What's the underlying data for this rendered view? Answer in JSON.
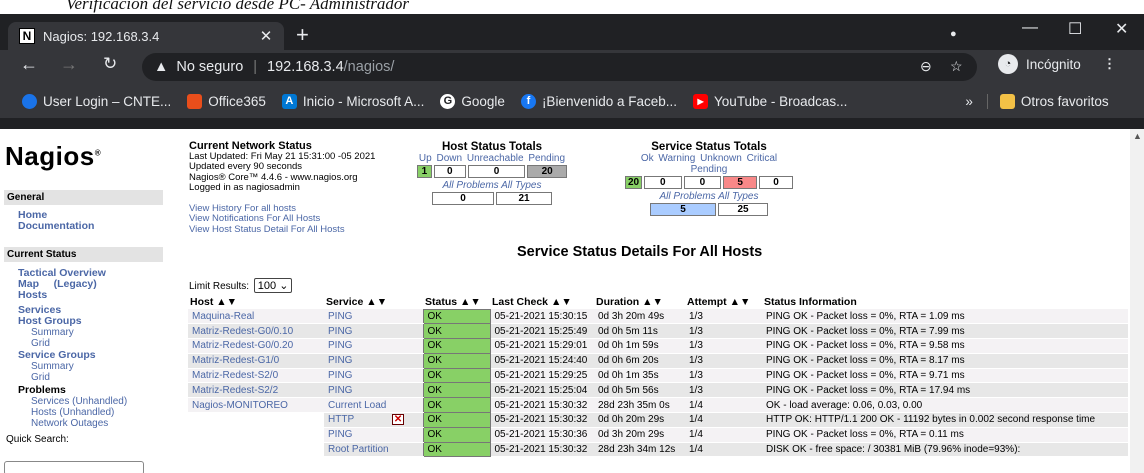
{
  "doc_caption": "Verificación del servicio desde PC- Administrador",
  "browser": {
    "tab_title": "Nagios: 192.168.3.4",
    "tab_favicon": "N",
    "security_label": "No seguro",
    "url_host": "192.168.3.4",
    "url_path": "/nagios/",
    "incognito_label": "Incógnito",
    "bookmarks": [
      {
        "label": "User Login – CNTE...",
        "icon": "blue-dot-icon",
        "color": "#1a73e8"
      },
      {
        "label": "Office365",
        "icon": "office-icon",
        "color": "#e94e1b"
      },
      {
        "label": "Inicio - Microsoft A...",
        "icon": "azure-icon",
        "color": "#0078d4"
      },
      {
        "label": "Google",
        "icon": "google-icon",
        "color": "#4285f4"
      },
      {
        "label": "¡Bienvenido a Faceb...",
        "icon": "facebook-icon",
        "color": "#1877f2"
      },
      {
        "label": "YouTube - Broadcas...",
        "icon": "youtube-icon",
        "color": "#ff0000"
      }
    ],
    "bookmarks_more": "»",
    "other_favorites": "Otros favoritos"
  },
  "sidebar": {
    "logo": "Nagios",
    "logo_mark": "®",
    "general_heading": "General",
    "general_items": [
      "Home",
      "Documentation"
    ],
    "current_status_heading": "Current Status",
    "items": [
      "Tactical Overview",
      "Map     (Legacy)",
      "Hosts",
      "Services",
      "Host Groups",
      "Summary",
      "Grid",
      "Service Groups",
      "Summary",
      "Grid",
      "Problems",
      "Services (Unhandled)",
      "Hosts (Unhandled)",
      "Network Outages"
    ],
    "quick_search": "Quick Search:"
  },
  "network_status": {
    "title": "Current Network Status",
    "updated": "Last Updated: Fri May 21 15:31:00 -05 2021",
    "every": "Updated every 90 seconds",
    "version": "Nagios® Core™ 4.4.6 - www.nagios.org",
    "logged": "Logged in as nagiosadmin",
    "links": [
      "View History For all hosts",
      "View Notifications For All Hosts",
      "View Host Status Detail For All Hosts"
    ]
  },
  "host_totals": {
    "title": "Host Status Totals",
    "headers": [
      "Up",
      "Down",
      "Unreachable",
      "Pending"
    ],
    "values": [
      "1",
      "0",
      "0",
      "20"
    ],
    "sub_headers": [
      "All Problems",
      "All Types"
    ],
    "sub_values": [
      "0",
      "21"
    ]
  },
  "service_totals": {
    "title": "Service Status Totals",
    "headers": [
      "Ok",
      "Warning",
      "Unknown",
      "Critical",
      "Pending"
    ],
    "values": [
      "20",
      "0",
      "0",
      "5",
      "0"
    ],
    "sub_headers": [
      "All Problems",
      "All Types"
    ],
    "sub_values": [
      "5",
      "25"
    ]
  },
  "details_title": "Service Status Details For All Hosts",
  "limit_label": "Limit Results:",
  "limit_value": "100",
  "columns": [
    "Host",
    "Service",
    "Status",
    "Last Check",
    "Duration",
    "Attempt",
    "Status Information"
  ],
  "rows": [
    {
      "host": "Maquina-Real",
      "service": "PING",
      "status": "OK",
      "last": "05-21-2021 15:30:15",
      "dur": "0d 3h 20m 49s",
      "att": "1/3",
      "info": "PING OK - Packet loss = 0%, RTA = 1.09 ms"
    },
    {
      "host": "Matriz-Redest-G0/0.10",
      "service": "PING",
      "status": "OK",
      "last": "05-21-2021 15:25:49",
      "dur": "0d 0h 5m 11s",
      "att": "1/3",
      "info": "PING OK - Packet loss = 0%, RTA = 7.99 ms"
    },
    {
      "host": "Matriz-Redest-G0/0.20",
      "service": "PING",
      "status": "OK",
      "last": "05-21-2021 15:29:01",
      "dur": "0d 0h 1m 59s",
      "att": "1/3",
      "info": "PING OK - Packet loss = 0%, RTA = 9.58 ms"
    },
    {
      "host": "Matriz-Redest-G1/0",
      "service": "PING",
      "status": "OK",
      "last": "05-21-2021 15:24:40",
      "dur": "0d 0h 6m 20s",
      "att": "1/3",
      "info": "PING OK - Packet loss = 0%, RTA = 8.17 ms"
    },
    {
      "host": "Matriz-Redest-S2/0",
      "service": "PING",
      "status": "OK",
      "last": "05-21-2021 15:29:25",
      "dur": "0d 0h 1m 35s",
      "att": "1/3",
      "info": "PING OK - Packet loss = 0%, RTA = 9.71 ms"
    },
    {
      "host": "Matriz-Redest-S2/2",
      "service": "PING",
      "status": "OK",
      "last": "05-21-2021 15:25:04",
      "dur": "0d 0h 5m 56s",
      "att": "1/3",
      "info": "PING OK - Packet loss = 0%, RTA = 17.94 ms"
    },
    {
      "host": "Nagios-MONITOREO",
      "service": "Current Load",
      "status": "OK",
      "last": "05-21-2021 15:30:32",
      "dur": "28d 23h 35m 0s",
      "att": "1/4",
      "info": "OK - load average: 0.06, 0.03, 0.00"
    },
    {
      "host": "",
      "service": "HTTP",
      "status": "OK",
      "last": "05-21-2021 15:30:32",
      "dur": "0d 0h 20m 29s",
      "att": "1/4",
      "info": "HTTP OK: HTTP/1.1 200 OK - 11192 bytes in 0.002 second response time"
    },
    {
      "host": "",
      "service": "PING",
      "status": "OK",
      "last": "05-21-2021 15:30:36",
      "dur": "0d 3h 20m 29s",
      "att": "1/4",
      "info": "PING OK - Packet loss = 0%, RTA = 0.11 ms"
    },
    {
      "host": "",
      "service": "Root Partition",
      "status": "OK",
      "last": "05-21-2021 15:30:32",
      "dur": "28d 23h 34m 12s",
      "att": "1/4",
      "info": "DISK OK - free space: / 30381 MiB (79.96% inode=93%):"
    }
  ],
  "sort_glyph": "▲▼",
  "colors": {
    "ok": "#88d066",
    "critical": "#f88888",
    "pending": "#aaaaaa",
    "link": "#4b67a6"
  }
}
